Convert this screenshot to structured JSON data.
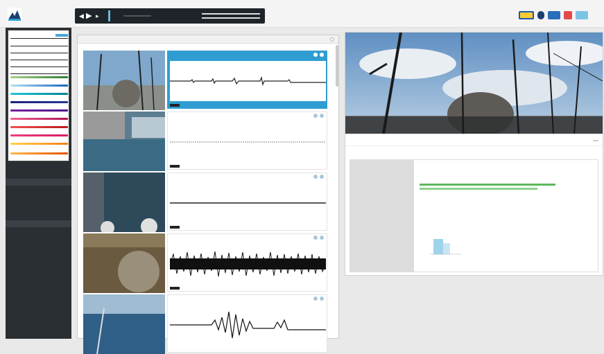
{
  "logo": {
    "title": "",
    "subtitle": ""
  },
  "player": {
    "play_label": "▶",
    "prev_label": "◀",
    "next_label": "▸"
  },
  "colors": {
    "accent": "#2f9dd1",
    "sidebar": "#2a2f33",
    "player": "#1e2429",
    "green": "#5cb85c"
  },
  "sidebar": {
    "filters": [],
    "menu": []
  },
  "list": {
    "title": "",
    "items": []
  },
  "detail": {
    "caption": "",
    "credit": "",
    "heading": "",
    "button": "",
    "description": "",
    "rows": []
  },
  "icons": [
    "play-icon",
    "prev-icon",
    "next-icon",
    "close-icon",
    "info-icon",
    "expand-icon",
    "camera-icon"
  ]
}
